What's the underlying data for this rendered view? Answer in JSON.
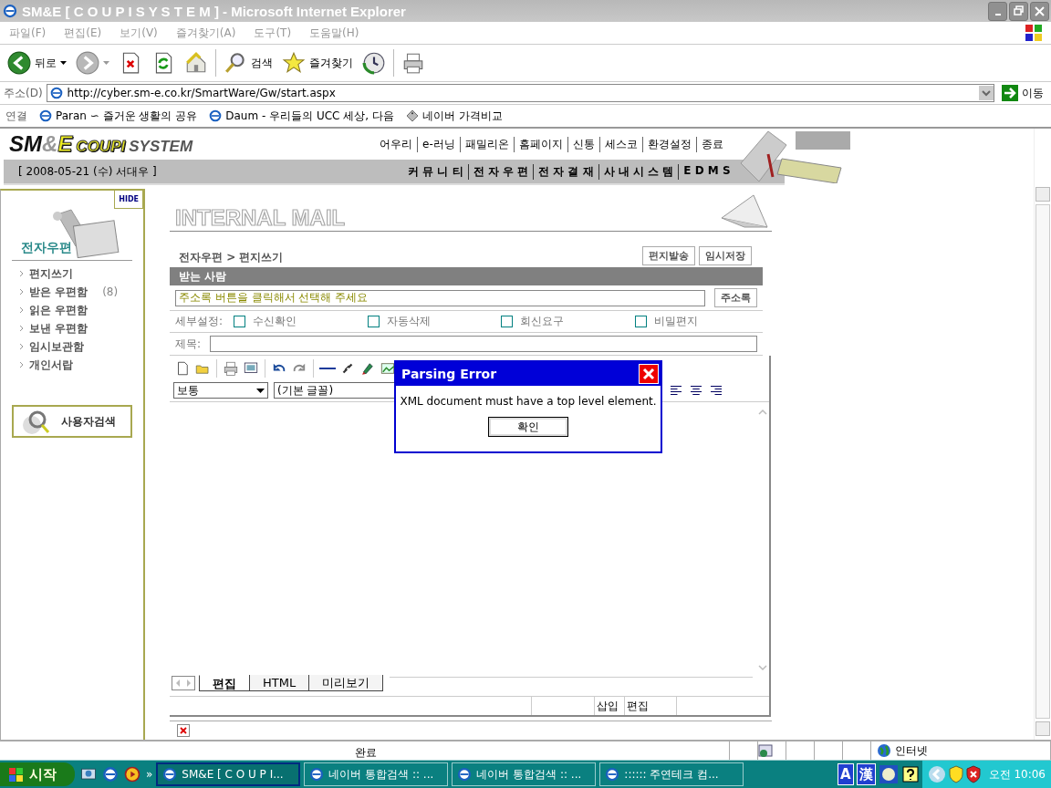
{
  "window": {
    "title": "SM&E [ C O U P I S Y S T E M ] - Microsoft Internet Explorer"
  },
  "menu": [
    "파일(F)",
    "편집(E)",
    "보기(V)",
    "즐겨찾기(A)",
    "도구(T)",
    "도움말(H)"
  ],
  "toolbar": [
    {
      "kind": "back",
      "label": "뒤로",
      "dropdown": true
    },
    {
      "kind": "forward",
      "dropdown": true
    },
    {
      "kind": "stop"
    },
    {
      "kind": "refresh"
    },
    {
      "kind": "home"
    },
    {
      "kind": "search",
      "label": "검색"
    },
    {
      "kind": "favorites",
      "label": "즐겨찾기"
    },
    {
      "kind": "history"
    },
    {
      "kind": "print"
    }
  ],
  "address": {
    "label": "주소(D)",
    "url": "http://cyber.sm-e.co.kr/SmartWare/Gw/start.aspx",
    "go": "이동"
  },
  "links": {
    "label": "연결",
    "items": [
      {
        "kind": "ie",
        "label": "Paran ∽ 즐거운 생활의 공유"
      },
      {
        "kind": "ie",
        "label": "Daum - 우리들의 UCC 세상, 다음"
      },
      {
        "kind": "tag",
        "label": "네이버 가격비교"
      }
    ]
  },
  "site": {
    "logo": [
      {
        "kind": "dark",
        "text": "SM"
      },
      {
        "kind": "light",
        "text": "&"
      },
      {
        "kind": "accent",
        "text": "E"
      },
      {
        "kind": "accent-small",
        "text": "COUPI"
      },
      {
        "kind": "dark-small",
        "text": "SYSTEM"
      }
    ],
    "top_nav": [
      "어우리",
      "e-러닝",
      "패밀리온",
      "홈페이지",
      "신통",
      "세스코",
      "환경설정",
      "종료"
    ],
    "date_user": "[ 2008-05-21 (수) 서대우 ]",
    "sub_nav": [
      "커 뮤 니 티",
      "전 자 우 편",
      "전 자 결 재",
      "사 내 시 스 템",
      "E D M S"
    ]
  },
  "sidebar": {
    "hide": "HIDE",
    "title": "전자우편",
    "items": [
      {
        "label": "편지쓰기"
      },
      {
        "label": "받은 우편함",
        "count": "(8)"
      },
      {
        "label": "읽은 우편함"
      },
      {
        "label": "보낸 우편함"
      },
      {
        "label": "임시보관함"
      },
      {
        "label": "개인서랍"
      }
    ],
    "search_button": "사용자검색"
  },
  "mail": {
    "heading": "INTERNAL MAIL",
    "breadcrumb": "전자우편 > 편지쓰기",
    "actions": [
      "편지발송",
      "임시저장"
    ],
    "section": "받는 사람",
    "recipient": "주소록 버튼을 클릭해서 선택해 주세요",
    "address_book": "주소록",
    "options_label": "세부설정:",
    "options": [
      {
        "label": "수신확인",
        "checked": false
      },
      {
        "label": "자동삭제",
        "checked": false
      },
      {
        "label": "회신요구",
        "checked": false
      },
      {
        "label": "비밀편지",
        "checked": false
      }
    ],
    "subject_label": "제목:",
    "editor_tools": [
      {
        "kind": "new"
      },
      {
        "kind": "open"
      },
      {
        "kind": "sep"
      },
      {
        "kind": "print"
      },
      {
        "kind": "preview"
      },
      {
        "kind": "sep"
      },
      {
        "kind": "undo"
      },
      {
        "kind": "redo"
      },
      {
        "kind": "sep"
      },
      {
        "kind": "line"
      },
      {
        "kind": "link"
      },
      {
        "kind": "marker"
      },
      {
        "kind": "image"
      }
    ],
    "size_select": "보통",
    "font_select": "(기본 글꼴)",
    "align_tools": [
      {
        "kind": "left"
      },
      {
        "kind": "center"
      },
      {
        "kind": "right"
      }
    ],
    "tabs": [
      {
        "label": "편집",
        "selected": true
      },
      {
        "label": "HTML",
        "selected": false
      },
      {
        "label": "미리보기",
        "selected": false
      }
    ],
    "status_cells": [
      "삽입",
      "편집"
    ]
  },
  "dialog": {
    "title": "Parsing Error",
    "message": "XML document must have a top level element.",
    "button": "확인"
  },
  "status_bar": {
    "text": "완료",
    "zone": "인터넷"
  },
  "taskbar": {
    "start": "시작",
    "quick_launch": [
      {
        "kind": "desktop"
      },
      {
        "kind": "ie"
      },
      {
        "kind": "media"
      }
    ],
    "more": "»",
    "tasks": [
      {
        "label": "SM&E [ C O U P I...",
        "selected": true
      },
      {
        "label": "네이버 통합검색 :: ...",
        "selected": false
      },
      {
        "label": "네이버 통합검색 :: ...",
        "selected": false
      },
      {
        "label": ":::::: 주연테크 컴...",
        "selected": false
      }
    ],
    "tray_keys": [
      "A",
      "漢"
    ],
    "clock": "오전 10:06"
  }
}
